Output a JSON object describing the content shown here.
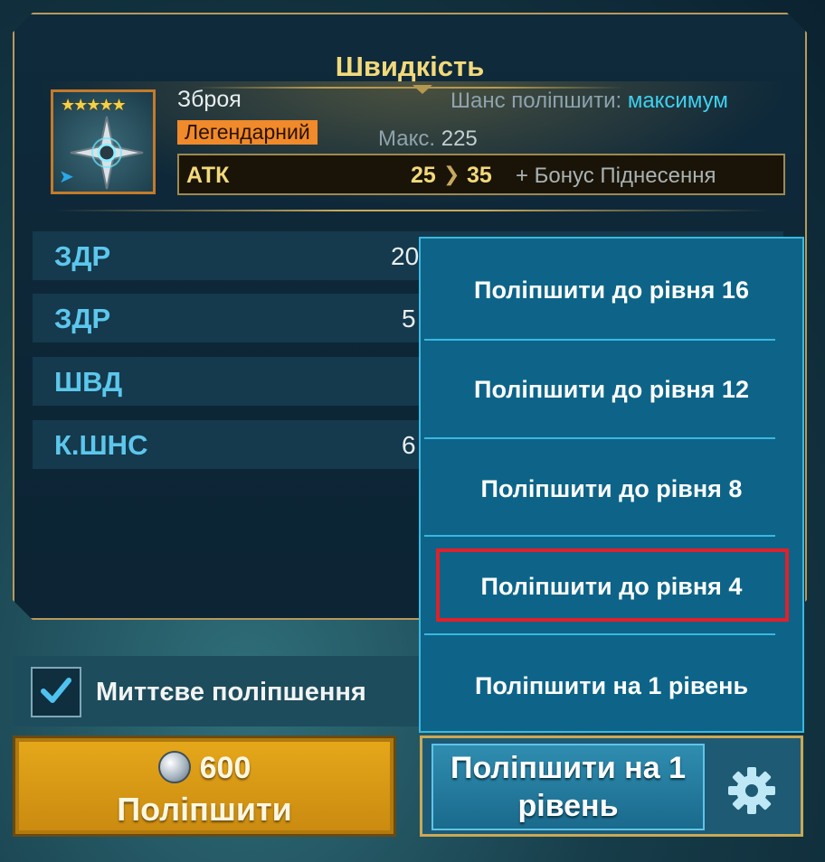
{
  "panel": {
    "title": "Швидкість"
  },
  "item": {
    "stars": "★★★★★",
    "type": "Зброя",
    "rarity": "Легендарний",
    "chance_label": "Шанс поліпшити:",
    "chance_value": "максимум",
    "max_label": "Макс.",
    "max_value": "225"
  },
  "main_stat": {
    "name": "АТК",
    "from": "25",
    "to": "35",
    "bonus": "+ Бонус Піднесення"
  },
  "substats": [
    {
      "name": "ЗДР",
      "value": "20"
    },
    {
      "name": "ЗДР",
      "value": "5"
    },
    {
      "name": "ШВД",
      "value": ""
    },
    {
      "name": "К.ШНС",
      "value": "6"
    }
  ],
  "instant_upgrade": {
    "label": "Миттєве поліпшення",
    "checked": true
  },
  "upgrade_button": {
    "cost": "600",
    "label": "Поліпшити"
  },
  "level_button": {
    "label_line1": "Поліпшити на 1",
    "label_line2": "рівень"
  },
  "dropdown": {
    "items": [
      {
        "label": "Поліпшити до рівня 16"
      },
      {
        "label": "Поліпшити до рівня 12"
      },
      {
        "label": "Поліпшити до рівня 8"
      },
      {
        "label": "Поліпшити до рівня 4",
        "highlighted": true
      },
      {
        "label": "Поліпшити на 1 рівень"
      }
    ]
  },
  "colors": {
    "accent_gold": "#f2d97a",
    "stat_blue": "#5cc7ec",
    "rarity_orange": "#f08a2a",
    "highlight_red": "#e0202a"
  }
}
